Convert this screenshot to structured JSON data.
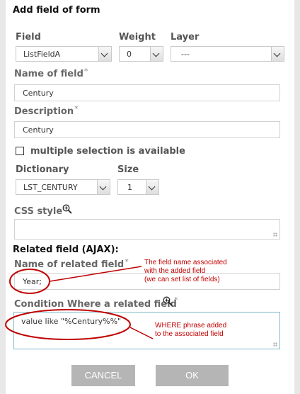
{
  "dialog": {
    "title": "Add field of form"
  },
  "field": {
    "label": "Field",
    "value": "ListFieldA"
  },
  "weight": {
    "label": "Weight",
    "value": "0"
  },
  "layer": {
    "label": "Layer",
    "value": "---"
  },
  "name_of_field": {
    "label": "Name of field",
    "required": "*",
    "value": "Century"
  },
  "description": {
    "label": "Description",
    "required": "*",
    "value": "Century"
  },
  "multiple_selection": {
    "label": "multiple selection is available",
    "checked": false
  },
  "dictionary": {
    "label": "Dictionary",
    "value": "LST_CENTURY"
  },
  "size": {
    "label": "Size",
    "value": "1"
  },
  "css_style": {
    "label": "CSS style",
    "value": ""
  },
  "related_section": {
    "title": "Related field (AJAX):"
  },
  "related_name": {
    "label": "Name of related field",
    "required": "*",
    "value": "Year;"
  },
  "condition": {
    "label": "Condition Where a related field",
    "required": "*",
    "value": "value like \"%Century%%\""
  },
  "annotations": {
    "note1": [
      "The field name associated",
      "with the added field",
      "(we can set list of fields)"
    ],
    "note2": [
      "WHERE phrase added",
      "to the associated field"
    ],
    "color": "#c00000"
  },
  "buttons": {
    "cancel": "CANCEL",
    "ok": "OK",
    "bg": "#b5b5b5"
  }
}
